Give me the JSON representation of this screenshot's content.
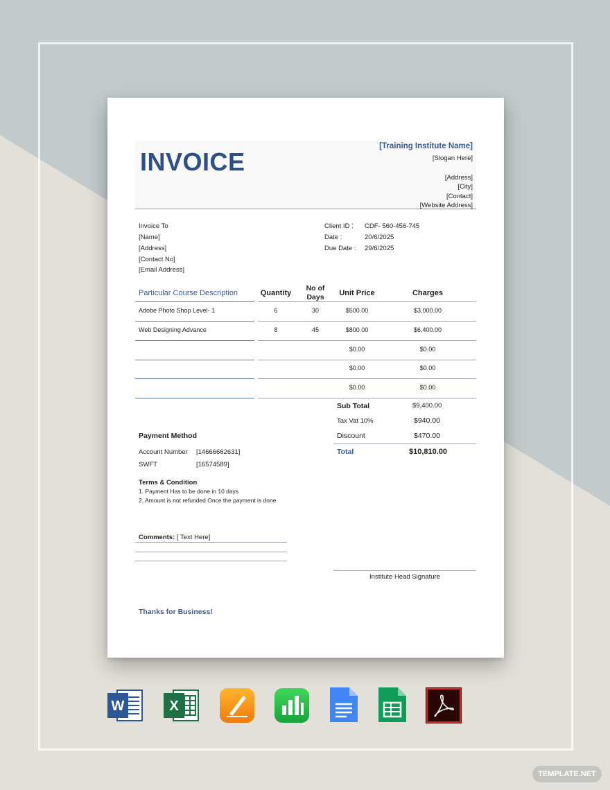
{
  "invoice": {
    "title": "INVOICE",
    "institute_name": "[Training Institute Name]",
    "slogan": "[Slogan Here]",
    "address": "[Address]",
    "city": "[City]",
    "contact": "[Contact]",
    "website": "[Website Address]"
  },
  "bill_to": {
    "label": "Invoice To",
    "name": "[Name]",
    "address": "[Address]",
    "contact_no": "[Contact No]",
    "email": "[Email Address]"
  },
  "client": {
    "client_id_label": "Client ID :",
    "client_id": "CDF- 560-456-745",
    "date_label": "Date :",
    "date": "20/6/2025",
    "due_label": "Due Date :",
    "due": "29/6/2025"
  },
  "table": {
    "headers": [
      "Particular Course Description",
      "Quantity",
      "No of Days",
      "Unit Price",
      "Charges"
    ],
    "header_days_line1": "No of",
    "header_days_line2": "Days",
    "rows": [
      {
        "desc": "Adobe Photo Shop Level- 1",
        "qty": "6",
        "days": "30",
        "unit": "$500.00",
        "charge": "$3,000.00"
      },
      {
        "desc": "Web Designing Advance",
        "qty": "8",
        "days": "45",
        "unit": "$800.00",
        "charge": "$6,400.00"
      },
      {
        "desc": "",
        "qty": "",
        "days": "",
        "unit": "$0.00",
        "charge": "$0.00"
      },
      {
        "desc": "",
        "qty": "",
        "days": "",
        "unit": "$0.00",
        "charge": "$0.00"
      },
      {
        "desc": "",
        "qty": "",
        "days": "",
        "unit": "$0.00",
        "charge": "$0.00"
      }
    ]
  },
  "totals": {
    "subtotal_label": "Sub Total",
    "subtotal": "$9,400.00",
    "tax_label": "Tax Vat 10%",
    "tax": "$940.00",
    "discount_label": "Discount",
    "discount": "$470.00",
    "total_label": "Total",
    "total": "$10,810.00"
  },
  "payment": {
    "title": "Payment Method",
    "account_label": "Account Number",
    "account": "[14666662631]",
    "swift_label": "SWFT",
    "swift": "[16574589]"
  },
  "terms": {
    "title": "Terms & Condition",
    "line1": "1. Payment Has to be done in 10 days",
    "line2": "2. Amount is not refunded Once the payment is done"
  },
  "comments": {
    "label": "Comments:",
    "text": "[ Text Here]"
  },
  "signature": "Institute Head Signature",
  "thanks": "Thanks for Business!",
  "icons": [
    "word-icon",
    "excel-icon",
    "pages-icon",
    "numbers-icon",
    "google-docs-icon",
    "google-sheets-icon",
    "pdf-icon"
  ],
  "watermark": "TEMPLATE.NET",
  "colors": {
    "accent": "#2f4f87",
    "background_top": "#c2cacb",
    "background_bottom": "#e3e0da"
  }
}
